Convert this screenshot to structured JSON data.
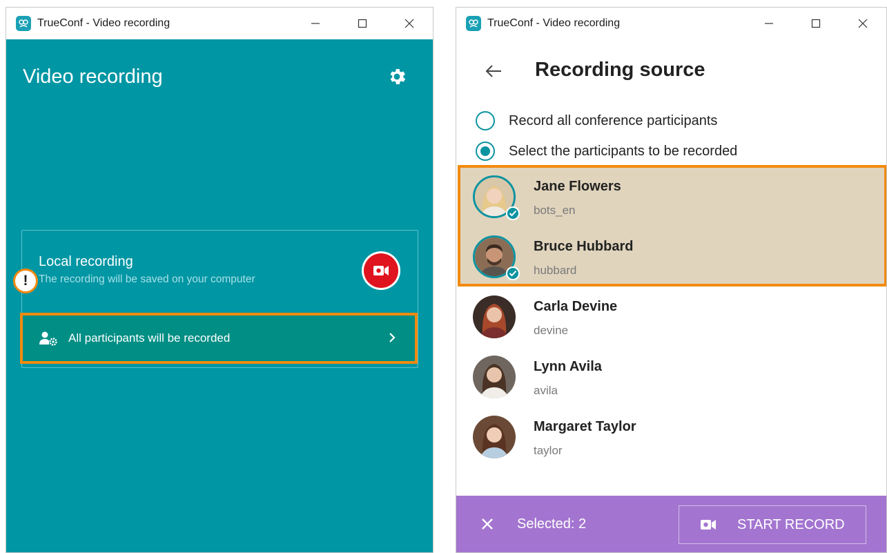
{
  "left_window": {
    "title": "TrueConf - Video recording",
    "heading": "Video recording",
    "card": {
      "title": "Local recording",
      "subtitle": "The recording will be saved on your computer"
    },
    "participants_row": "All participants will be recorded",
    "warning_mark": "!"
  },
  "right_window": {
    "title": "TrueConf - Video recording",
    "heading": "Recording source",
    "options": [
      {
        "label": "Record all conference participants",
        "selected": false
      },
      {
        "label": "Select the participants to be recorded",
        "selected": true
      }
    ],
    "participants": [
      {
        "name": "Jane Flowers",
        "login": "bots_en",
        "selected": true
      },
      {
        "name": "Bruce Hubbard",
        "login": "hubbard",
        "selected": true
      },
      {
        "name": "Carla Devine",
        "login": "devine",
        "selected": false
      },
      {
        "name": "Lynn Avila",
        "login": "avila",
        "selected": false
      },
      {
        "name": "Margaret Taylor",
        "login": "taylor",
        "selected": false
      }
    ],
    "selected_label": "Selected: 2",
    "start_button": "START RECORD"
  },
  "colors": {
    "teal": "#0096a4",
    "highlight": "#f28a0f",
    "purple_bar": "#a375d0",
    "record_red": "#e0141e"
  },
  "icons": [
    "app-icon",
    "minimize-icon",
    "maximize-icon",
    "close-icon",
    "gear-icon",
    "video-camera-icon",
    "participants-settings-icon",
    "chevron-right-icon",
    "back-arrow-icon",
    "checkmark-icon"
  ]
}
